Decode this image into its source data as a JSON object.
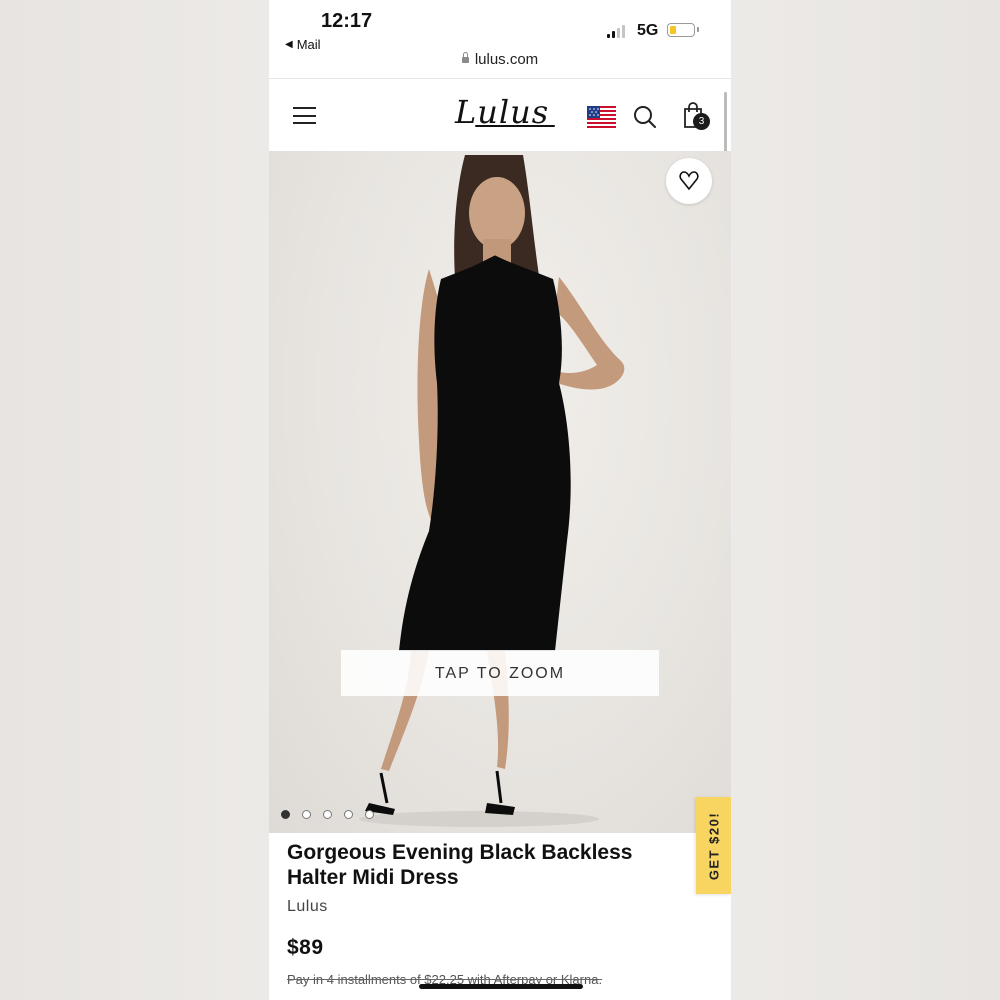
{
  "status_bar": {
    "time": "12:17",
    "back_app": "Mail",
    "network": "5G",
    "url": "lulus.com"
  },
  "header": {
    "logo_text": "Lulus",
    "cart_count": "3",
    "icons": [
      "menu-icon",
      "us-flag-icon",
      "search-icon",
      "shopping-bag-icon"
    ]
  },
  "gallery": {
    "zoom_label": "TAP TO ZOOM",
    "image_count": 5,
    "active_index": 0
  },
  "product": {
    "title": "Gorgeous Evening Black Backless Halter Midi Dress",
    "brand": "Lulus",
    "price": "$89",
    "installments": "Pay in 4 installments of $22.25 with Afterpay or Klarna."
  },
  "promo": {
    "label": "GET $20!",
    "color": "#f7d560"
  }
}
